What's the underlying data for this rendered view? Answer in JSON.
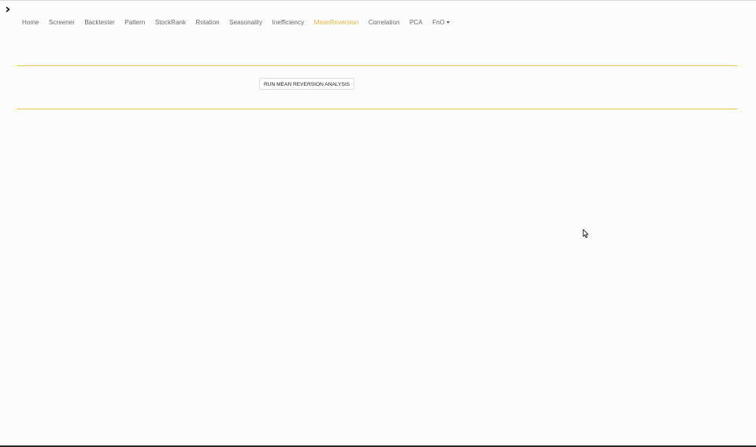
{
  "nav": {
    "items": [
      {
        "label": "Home",
        "active": false
      },
      {
        "label": "Screener",
        "active": false
      },
      {
        "label": "Backtester",
        "active": false
      },
      {
        "label": "Pattern",
        "active": false
      },
      {
        "label": "StockRank",
        "active": false
      },
      {
        "label": "Rotation",
        "active": false
      },
      {
        "label": "Seasonality",
        "active": false
      },
      {
        "label": "Inefficiency",
        "active": false
      },
      {
        "label": "MeanReversion",
        "active": true
      },
      {
        "label": "Correlation",
        "active": false
      },
      {
        "label": "PCA",
        "active": false
      },
      {
        "label": "FnO",
        "active": false,
        "has_dropdown": true
      }
    ]
  },
  "main": {
    "run_button_label": "RUN MEAN REVERSION ANALYSIS"
  },
  "icons": {
    "sidebar_toggle": "chevron-right-icon",
    "dropdown": "caret-down-icon",
    "pointer": "mouse-pointer-icon"
  },
  "colors": {
    "accent": "#e0b43a",
    "divider": "#f0c64a",
    "nav_text": "#666666",
    "background": "#fcfcfc"
  }
}
